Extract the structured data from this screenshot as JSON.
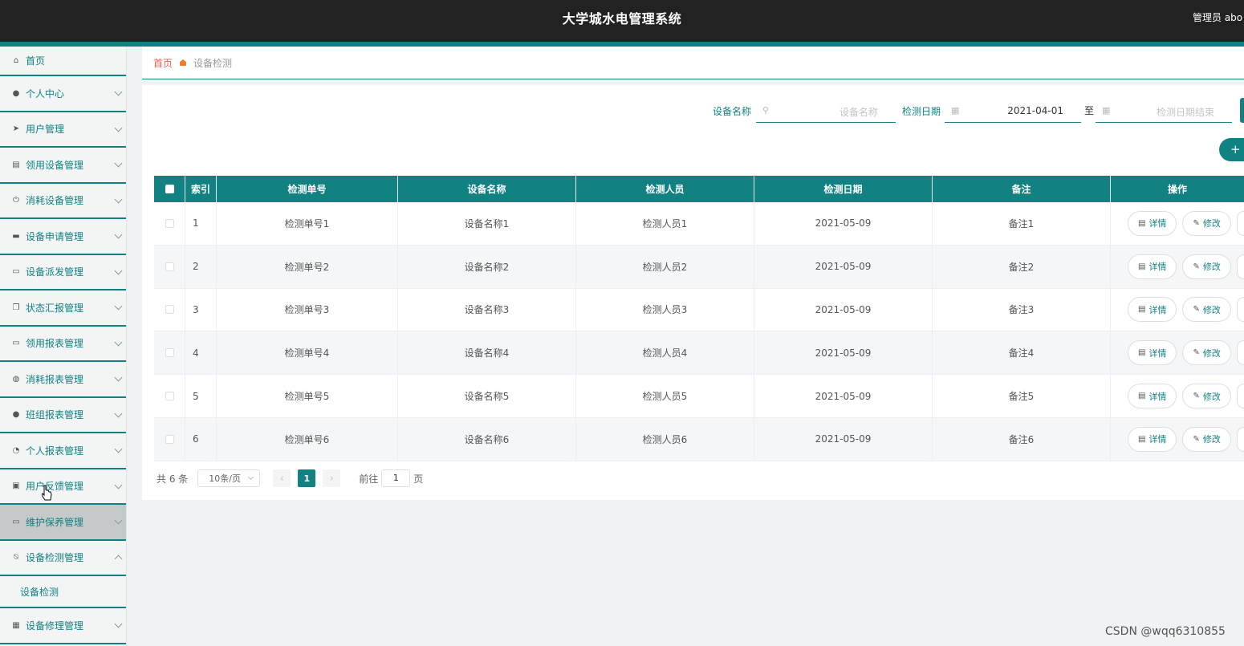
{
  "header": {
    "title": "大学城水电管理系统",
    "user": "管理员 abo"
  },
  "sidebar": {
    "items": [
      {
        "label": "首页",
        "icon": "home-icon",
        "glyph": "⌂"
      },
      {
        "label": "个人中心",
        "icon": "user-icon",
        "glyph": "●"
      },
      {
        "label": "用户管理",
        "icon": "send-icon",
        "glyph": "➤"
      },
      {
        "label": "领用设备管理",
        "icon": "chart-icon",
        "glyph": "▤"
      },
      {
        "label": "消耗设备管理",
        "icon": "power-icon",
        "glyph": "⏻"
      },
      {
        "label": "设备申请管理",
        "icon": "stamp-icon",
        "glyph": "▬"
      },
      {
        "label": "设备派发管理",
        "icon": "laptop-icon",
        "glyph": "▭"
      },
      {
        "label": "状态汇报管理",
        "icon": "copy-icon",
        "glyph": "❐"
      },
      {
        "label": "领用报表管理",
        "icon": "wallet-icon",
        "glyph": "▭"
      },
      {
        "label": "消耗报表管理",
        "icon": "basketball-icon",
        "glyph": "◍"
      },
      {
        "label": "班组报表管理",
        "icon": "custom-user-icon",
        "glyph": "●"
      },
      {
        "label": "个人报表管理",
        "icon": "clock-icon",
        "glyph": "◔"
      },
      {
        "label": "用户反馈管理",
        "icon": "clipboard-icon",
        "glyph": "▣"
      },
      {
        "label": "维护保养管理",
        "icon": "chat-icon",
        "glyph": "▭"
      },
      {
        "label": "设备检测管理",
        "icon": "bell-off-icon",
        "glyph": "⍉"
      }
    ],
    "sub_item": "设备检测",
    "last_item": {
      "label": "设备修理管理",
      "icon": "grid-icon",
      "glyph": "▦"
    }
  },
  "breadcrumb": {
    "home": "首页",
    "current": "设备检测"
  },
  "search": {
    "name_label": "设备名称",
    "name_placeholder": "设备名称",
    "date_label": "检测日期",
    "date_start": "2021-04-01",
    "date_to": "至",
    "date_end_placeholder": "检测日期结束"
  },
  "add_button": "+",
  "table": {
    "columns": [
      "索引",
      "检测单号",
      "设备名称",
      "检测人员",
      "检测日期",
      "备注",
      "操作"
    ],
    "rows": [
      {
        "idx": "1",
        "no": "检测单号1",
        "name": "设备名称1",
        "person": "检测人员1",
        "date": "2021-05-09",
        "note": "备注1"
      },
      {
        "idx": "2",
        "no": "检测单号2",
        "name": "设备名称2",
        "person": "检测人员2",
        "date": "2021-05-09",
        "note": "备注2"
      },
      {
        "idx": "3",
        "no": "检测单号3",
        "name": "设备名称3",
        "person": "检测人员3",
        "date": "2021-05-09",
        "note": "备注3"
      },
      {
        "idx": "4",
        "no": "检测单号4",
        "name": "设备名称4",
        "person": "检测人员4",
        "date": "2021-05-09",
        "note": "备注4"
      },
      {
        "idx": "5",
        "no": "检测单号5",
        "name": "设备名称5",
        "person": "检测人员5",
        "date": "2021-05-09",
        "note": "备注5"
      },
      {
        "idx": "6",
        "no": "检测单号6",
        "name": "设备名称6",
        "person": "检测人员6",
        "date": "2021-05-09",
        "note": "备注6"
      }
    ],
    "detail_label": "详情",
    "edit_label": "修改"
  },
  "pagination": {
    "total": "共 6 条",
    "page_size": "10条/页",
    "prev": "‹",
    "current": "1",
    "next": "›",
    "goto_label": "前往",
    "goto_value": "1",
    "page_suffix": "页"
  },
  "watermark": "CSDN @wqq6310855",
  "colors": {
    "primary": "#128182",
    "header": "#222222",
    "breadcrumb_home": "#e95d52"
  }
}
